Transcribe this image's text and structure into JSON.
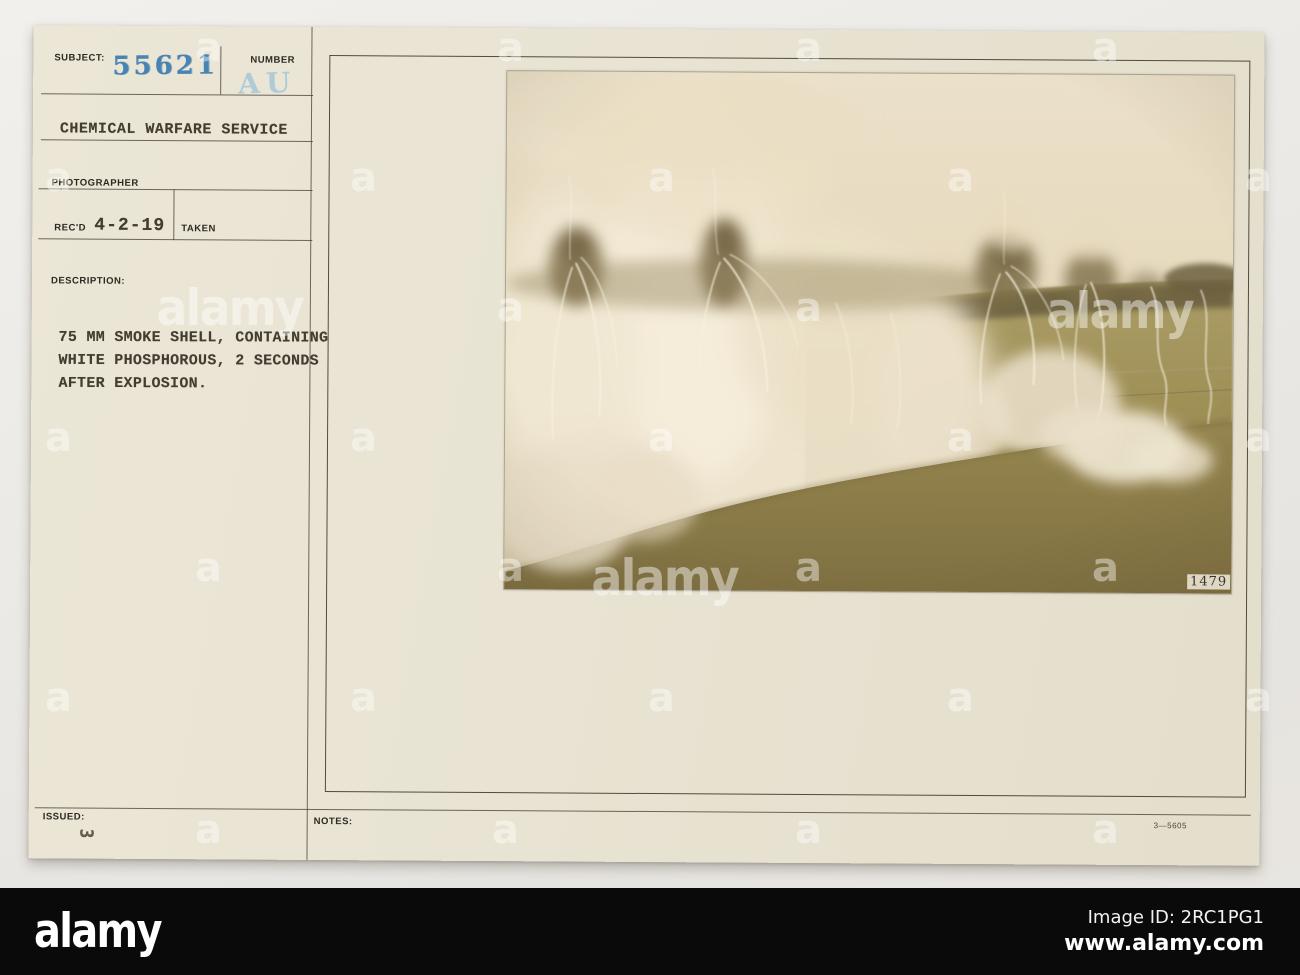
{
  "card": {
    "subject_label": "SUBJECT:",
    "subject_number": "55621",
    "number_label": "NUMBER",
    "number_stamp": "AU",
    "service_name": "CHEMICAL WARFARE SERVICE",
    "photographer_label": "PHOTOGRAPHER",
    "received_label": "REC'D",
    "received_date": "4-2-19",
    "taken_label": "TAKEN",
    "description_label": "DESCRIPTION:",
    "description_text": "75 MM SMOKE SHELL, CONTAINING\nWHITE PHOSPHOROUS, 2 SECONDS\nAFTER EXPLOSION.",
    "issued_label": "ISSUED:",
    "issued_mark": "3",
    "notes_label": "NOTES:",
    "form_code": "3—5605",
    "photo_number": "1479"
  },
  "watermark": {
    "letter": "a",
    "word": "alamy"
  },
  "footer": {
    "logo": "alamy",
    "image_id_line": "Image ID: 2RC1PG1",
    "website": "www.alamy.com"
  },
  "colors": {
    "stamp_blue": "#3c7bb2",
    "stamp_light_blue": "#a9c9d9",
    "card_cream": "#e8e3d2",
    "ink_dark": "#3f3a31",
    "footer_bg": "#0a0a0a"
  }
}
